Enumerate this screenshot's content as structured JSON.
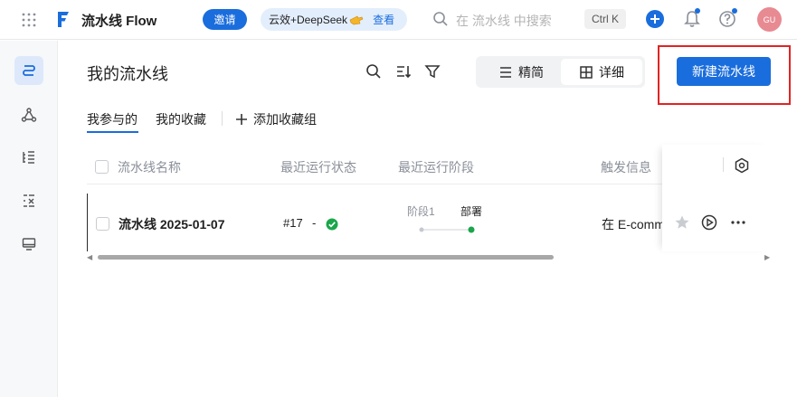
{
  "topbar": {
    "app_name": "流水线 Flow",
    "invite_label": "邀请",
    "promo_text": "云效+DeepSeek",
    "promo_link": "查看",
    "search_placeholder": "在 流水线 中搜索",
    "shortcut": "Ctrl K",
    "avatar_initials": "GU",
    "accent_color": "#1a6ddc",
    "avatar_color": "#e88a92",
    "icons": [
      "apps-grid-icon",
      "flow-logo-icon",
      "pointing-hand-icon",
      "search-icon",
      "plus-icon",
      "bell-icon",
      "help-icon"
    ]
  },
  "rail": {
    "icons": [
      "pipeline-icon",
      "graph-nodes-icon",
      "list-tree-icon",
      "list-x-icon",
      "monitor-icon"
    ]
  },
  "main": {
    "title": "我的流水线",
    "view_options": [
      {
        "label": "精简",
        "icon": "list-icon",
        "selected": false
      },
      {
        "label": "详细",
        "icon": "grid-icon",
        "selected": true
      }
    ],
    "create_label": "新建流水线",
    "tabs": [
      {
        "label": "我参与的",
        "active": true
      },
      {
        "label": "我的收藏",
        "active": false
      }
    ],
    "add_group_label": "添加收藏组"
  },
  "table": {
    "columns": [
      "流水线名称",
      "最近运行状态",
      "最近运行阶段",
      "触发信息"
    ],
    "rows": [
      {
        "name": "流水线 2025-01-07",
        "run_number": "#17",
        "run_sep": "-",
        "status": "success",
        "stage_1": "阶段1",
        "stage_2": "部署",
        "trigger": "在 E-comm"
      }
    ],
    "status_color": "#1aa64a"
  }
}
